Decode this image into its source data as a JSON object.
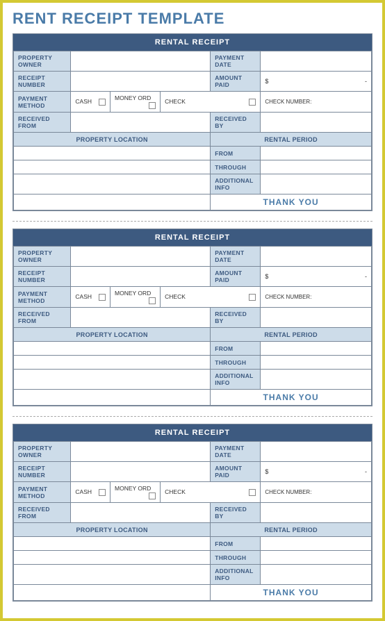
{
  "title": "RENT RECEIPT TEMPLATE",
  "receipt": {
    "header": "RENTAL RECEIPT",
    "propertyOwner": "PROPERTY OWNER",
    "paymentDate": "PAYMENT DATE",
    "receiptNumber": "RECEIPT NUMBER",
    "amountPaid": "AMOUNT PAID",
    "amountValue": "$",
    "amountDash": "-",
    "paymentMethod": "PAYMENT METHOD",
    "cash": "CASH",
    "moneyOrd": "MONEY ORD",
    "check": "CHECK",
    "checkNumber": "CHECK NUMBER:",
    "receivedFrom": "RECEIVED FROM",
    "receivedBy": "RECEIVED BY",
    "propertyLocation": "PROPERTY LOCATION",
    "rentalPeriod": "RENTAL PERIOD",
    "from": "FROM",
    "through": "THROUGH",
    "additionalInfo": "ADDITIONAL INFO",
    "thankYou": "THANK YOU"
  }
}
